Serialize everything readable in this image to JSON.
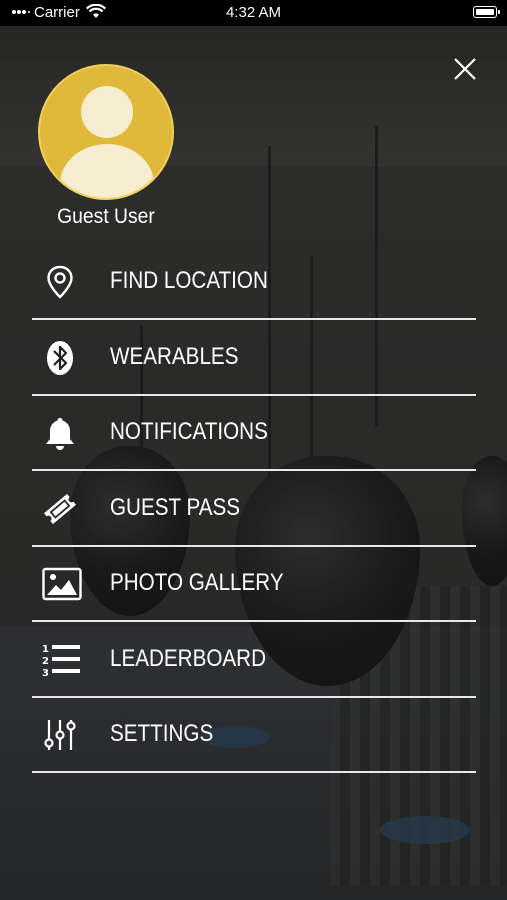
{
  "status_bar": {
    "carrier": "Carrier",
    "time": "4:32 AM"
  },
  "profile": {
    "name": "Guest User"
  },
  "menu": {
    "items": [
      {
        "label": "FIND LOCATION",
        "icon": "location-pin-icon"
      },
      {
        "label": "WEARABLES",
        "icon": "bluetooth-icon"
      },
      {
        "label": "NOTIFICATIONS",
        "icon": "bell-icon"
      },
      {
        "label": "GUEST PASS",
        "icon": "ticket-icon"
      },
      {
        "label": "PHOTO GALLERY",
        "icon": "image-icon"
      },
      {
        "label": "LEADERBOARD",
        "icon": "ranked-list-icon"
      },
      {
        "label": "SETTINGS",
        "icon": "sliders-icon"
      }
    ]
  },
  "colors": {
    "avatar": "#e0b83a",
    "divider": "#e8e8e8",
    "text": "#ffffff"
  }
}
